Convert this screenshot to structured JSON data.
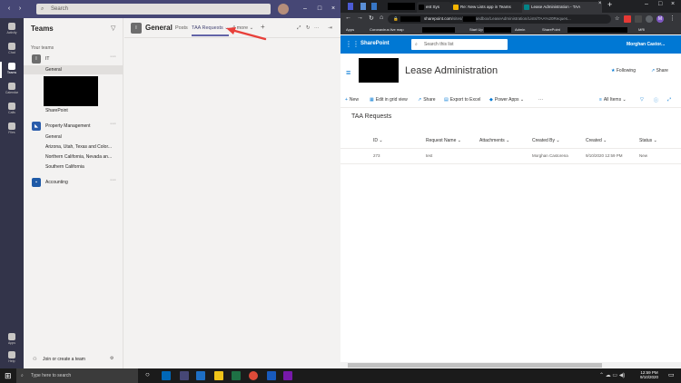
{
  "teams": {
    "search_placeholder": "Search",
    "rail": [
      "Activity",
      "Chat",
      "Teams",
      "Calendar",
      "Calls",
      "Files",
      "Apps",
      "Help"
    ],
    "panel_title": "Teams",
    "your_teams": "Your teams",
    "teams": [
      {
        "name": "IT",
        "initial": "I",
        "color": "#6d6d6d",
        "channels": [
          "General",
          "SharePoint"
        ]
      },
      {
        "name": "Property Management",
        "initial": "",
        "color": "#2a5caa",
        "channels": [
          "General",
          "Arizona, Utah, Texas and Color...",
          "Northern California, Nevada an...",
          "Southern California"
        ]
      },
      {
        "name": "Accounting",
        "initial": "",
        "color": "#1e5aa7",
        "channels": []
      }
    ],
    "join_label": "Join or create a team",
    "channel_title": "General",
    "tabs": [
      "Posts",
      "TAA Requests",
      "4 more"
    ]
  },
  "browser": {
    "tabs": [
      "ent Sys",
      "Re: New Lists app in Teams",
      "Lease Administration - TAA"
    ],
    "url_host": "sharepoint.com",
    "url_path": "/sites/",
    "url_rest": "andbox/LeaseAdministration/Lists/TAA%20Reques...",
    "bookmarks": [
      "Apps",
      "Coronavirus live map",
      "Start Up",
      "Admin",
      "SharePoint",
      "MRI"
    ]
  },
  "sharepoint": {
    "suite_title": "SharePoint",
    "search_placeholder": "Search this list",
    "user_name": "Morghan Castor...",
    "site_title": "Lease Administration",
    "following": "Following",
    "share": "Share",
    "commands": [
      "New",
      "Edit in grid view",
      "Share",
      "Export to Excel",
      "Power Apps",
      "···"
    ],
    "view": "All Items",
    "list_title": "TAA Requests",
    "columns": [
      "ID",
      "Request Name",
      "Attachments",
      "Created By",
      "Created",
      "Status"
    ],
    "rows": [
      {
        "id": "273",
        "request": "test",
        "attachments": "",
        "created_by": "Morghan Castorena",
        "created": "9/10/2020 12:59 PM",
        "status": "New"
      }
    ]
  },
  "taskbar": {
    "search_placeholder": "Type here to search",
    "time": "12:59 PM",
    "date": "9/10/2020"
  }
}
